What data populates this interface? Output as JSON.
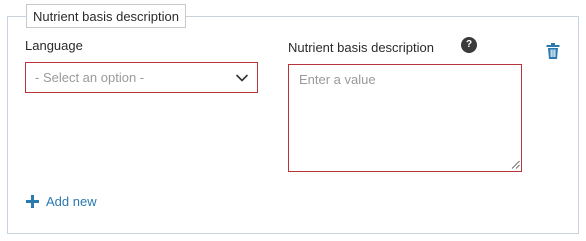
{
  "section": {
    "legend": "Nutrient basis description"
  },
  "language": {
    "label": "Language",
    "select_placeholder": "- Select an option -"
  },
  "description": {
    "label": "Nutrient basis description",
    "help_symbol": "?",
    "placeholder": "Enter a value"
  },
  "actions": {
    "add_new_label": "Add new"
  },
  "icons": {
    "help": "help-icon",
    "delete": "trash-icon",
    "dropdown": "chevron-down-icon",
    "add": "plus-icon"
  },
  "colors": {
    "error_border": "#b8343b",
    "link": "#2a7ab0",
    "trash": "#2a7ab0",
    "fieldset_border": "#c9d3de"
  }
}
